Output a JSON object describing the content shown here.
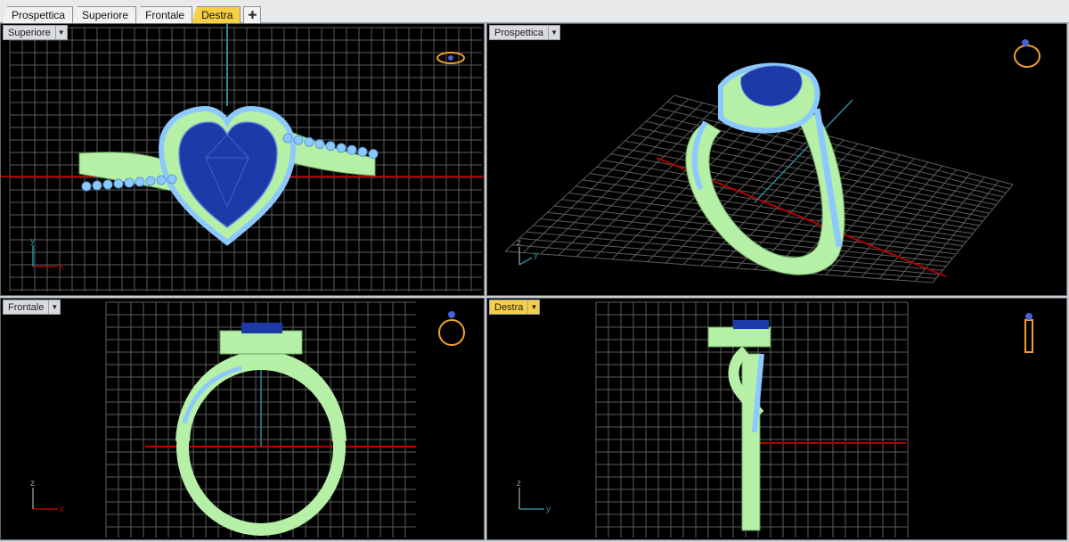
{
  "tabs": [
    {
      "label": "Prospettica",
      "active": false
    },
    {
      "label": "Superiore",
      "active": false
    },
    {
      "label": "Frontale",
      "active": false
    },
    {
      "label": "Destra",
      "active": true
    }
  ],
  "add_tab_icon": "plus-icon",
  "viewports": {
    "top": {
      "title": "Superiore",
      "axis_h": "x",
      "axis_v": "y"
    },
    "perspective": {
      "title": "Prospettica",
      "axis_h": "y",
      "axis_v": "z"
    },
    "front": {
      "title": "Frontale",
      "axis_h": "x",
      "axis_v": "z"
    },
    "right": {
      "title": "Destra",
      "axis_h": "y",
      "axis_v": "z",
      "active": true
    }
  },
  "colors": {
    "active_tab": "#f5cf46",
    "viewport_bg": "#000000",
    "grid": "#6e6e6e",
    "x_axis": "#b00000",
    "y_axis": "#2a8c96",
    "mesh": "#b6f0a6",
    "stones": "#8cc9ff",
    "gem": "#1e3aa8",
    "icon": "#f0a030"
  }
}
